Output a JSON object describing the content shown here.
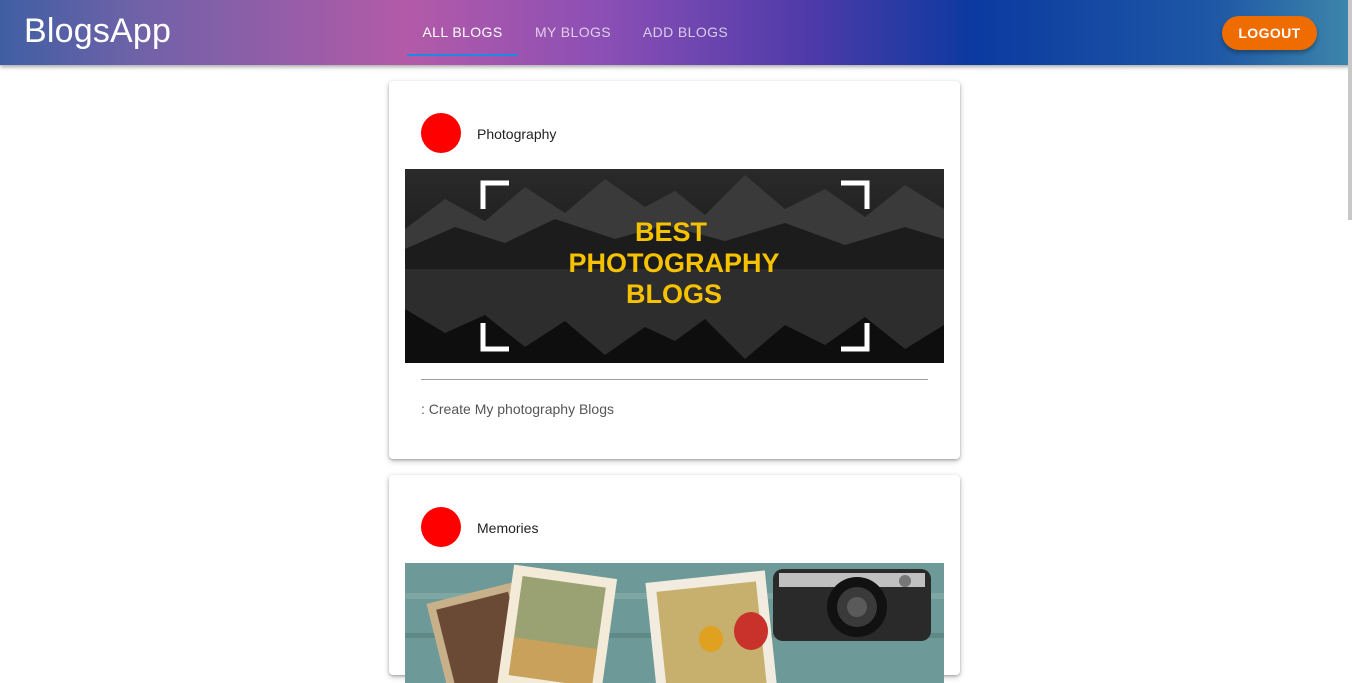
{
  "app": {
    "brand": "BlogsApp"
  },
  "nav": {
    "tabs": [
      {
        "label": "ALL BLOGS",
        "active": true
      },
      {
        "label": "MY BLOGS",
        "active": false
      },
      {
        "label": "ADD BLOGS",
        "active": false
      }
    ],
    "logout_label": "LOGOUT"
  },
  "colors": {
    "logout_button": "#ef6c00",
    "tab_indicator": "#1e88e5",
    "avatar": "#ff0000"
  },
  "blogs": [
    {
      "title": "Photography",
      "image_text": [
        "BEST",
        "PHOTOGRAPHY",
        "BLOGS"
      ],
      "description": ": Create My photography Blogs"
    },
    {
      "title": "Memories"
    }
  ]
}
